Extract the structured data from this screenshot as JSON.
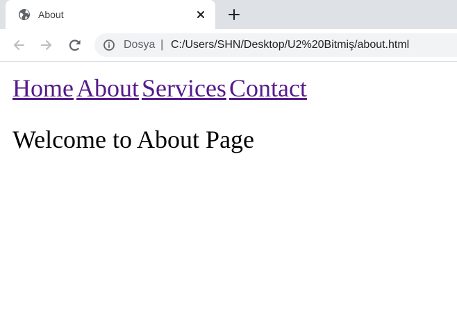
{
  "browser": {
    "tab": {
      "title": "About",
      "favicon": "globe-icon",
      "close_icon": "close-icon"
    },
    "new_tab_icon": "plus-icon",
    "toolbar": {
      "back_icon": "arrow-left-icon",
      "forward_icon": "arrow-right-icon",
      "reload_icon": "reload-icon",
      "info_icon": "info-icon",
      "origin_label": "Dosya",
      "separator": "|",
      "url": "C:/Users/SHN/Desktop/U2%20Bitmiş/about.html"
    }
  },
  "page": {
    "nav": [
      {
        "label": "Home"
      },
      {
        "label": "About"
      },
      {
        "label": "Services"
      },
      {
        "label": "Contact"
      }
    ],
    "heading": "Welcome to About Page"
  },
  "colors": {
    "tabstrip_bg": "#dee1e6",
    "omnibox_bg": "#f1f3f4",
    "visited_link": "#551a8b",
    "icon_gray": "#5f6368"
  }
}
